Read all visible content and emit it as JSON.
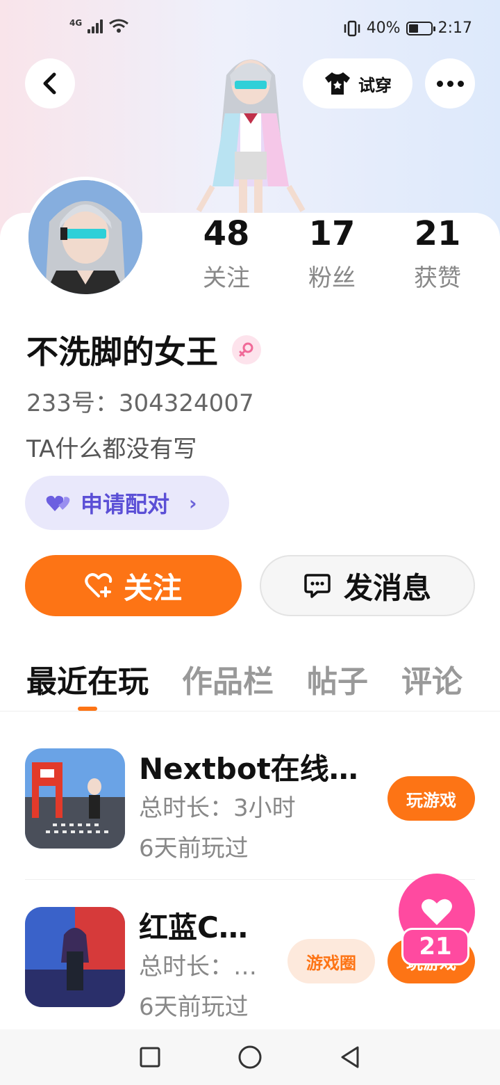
{
  "status_bar": {
    "network": "4G",
    "battery": "40%",
    "time": "2:17"
  },
  "header": {
    "back_icon": "chevron-left-icon",
    "tryon_label": "试穿",
    "more_icon": "more-dots-icon"
  },
  "profile": {
    "stats": [
      {
        "value": "48",
        "label": "关注"
      },
      {
        "value": "17",
        "label": "粉丝"
      },
      {
        "value": "21",
        "label": "获赞"
      }
    ],
    "username": "不洗脚的女王",
    "gender_icon": "female-icon",
    "uid": "233号：304324007",
    "bio": "TA什么都没有写",
    "pair_label": "申请配对",
    "pair_color": "#5b4fd6"
  },
  "actions": {
    "follow_label": "关注",
    "message_label": "发消息",
    "accent": "#fd7415"
  },
  "tabs": [
    {
      "label": "最近在玩",
      "active": true
    },
    {
      "label": "作品栏",
      "active": false
    },
    {
      "label": "帖子",
      "active": false
    },
    {
      "label": "评论",
      "active": false
    }
  ],
  "games": [
    {
      "title": "Nextbot在线…",
      "duration": "总时长：3小时",
      "last_played": "6天前玩过",
      "play_label": "玩游戏"
    },
    {
      "title": "红蓝C…",
      "duration": "总时长：…",
      "last_played": "6天前玩过",
      "circle_label": "游戏圈",
      "play_label": "玩游戏"
    }
  ],
  "like_fab": {
    "count": "21",
    "color": "#ff4aa0"
  }
}
